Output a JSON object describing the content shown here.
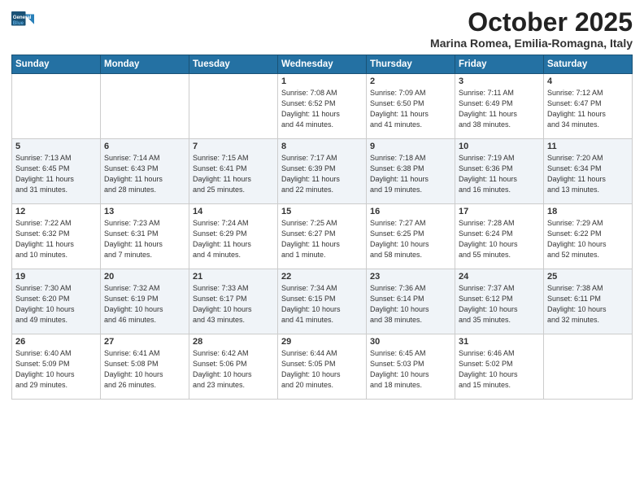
{
  "logo": {
    "line1": "General",
    "line2": "Blue"
  },
  "title": "October 2025",
  "location": "Marina Romea, Emilia-Romagna, Italy",
  "weekdays": [
    "Sunday",
    "Monday",
    "Tuesday",
    "Wednesday",
    "Thursday",
    "Friday",
    "Saturday"
  ],
  "weeks": [
    [
      {
        "day": "",
        "info": ""
      },
      {
        "day": "",
        "info": ""
      },
      {
        "day": "",
        "info": ""
      },
      {
        "day": "1",
        "info": "Sunrise: 7:08 AM\nSunset: 6:52 PM\nDaylight: 11 hours\nand 44 minutes."
      },
      {
        "day": "2",
        "info": "Sunrise: 7:09 AM\nSunset: 6:50 PM\nDaylight: 11 hours\nand 41 minutes."
      },
      {
        "day": "3",
        "info": "Sunrise: 7:11 AM\nSunset: 6:49 PM\nDaylight: 11 hours\nand 38 minutes."
      },
      {
        "day": "4",
        "info": "Sunrise: 7:12 AM\nSunset: 6:47 PM\nDaylight: 11 hours\nand 34 minutes."
      }
    ],
    [
      {
        "day": "5",
        "info": "Sunrise: 7:13 AM\nSunset: 6:45 PM\nDaylight: 11 hours\nand 31 minutes."
      },
      {
        "day": "6",
        "info": "Sunrise: 7:14 AM\nSunset: 6:43 PM\nDaylight: 11 hours\nand 28 minutes."
      },
      {
        "day": "7",
        "info": "Sunrise: 7:15 AM\nSunset: 6:41 PM\nDaylight: 11 hours\nand 25 minutes."
      },
      {
        "day": "8",
        "info": "Sunrise: 7:17 AM\nSunset: 6:39 PM\nDaylight: 11 hours\nand 22 minutes."
      },
      {
        "day": "9",
        "info": "Sunrise: 7:18 AM\nSunset: 6:38 PM\nDaylight: 11 hours\nand 19 minutes."
      },
      {
        "day": "10",
        "info": "Sunrise: 7:19 AM\nSunset: 6:36 PM\nDaylight: 11 hours\nand 16 minutes."
      },
      {
        "day": "11",
        "info": "Sunrise: 7:20 AM\nSunset: 6:34 PM\nDaylight: 11 hours\nand 13 minutes."
      }
    ],
    [
      {
        "day": "12",
        "info": "Sunrise: 7:22 AM\nSunset: 6:32 PM\nDaylight: 11 hours\nand 10 minutes."
      },
      {
        "day": "13",
        "info": "Sunrise: 7:23 AM\nSunset: 6:31 PM\nDaylight: 11 hours\nand 7 minutes."
      },
      {
        "day": "14",
        "info": "Sunrise: 7:24 AM\nSunset: 6:29 PM\nDaylight: 11 hours\nand 4 minutes."
      },
      {
        "day": "15",
        "info": "Sunrise: 7:25 AM\nSunset: 6:27 PM\nDaylight: 11 hours\nand 1 minute."
      },
      {
        "day": "16",
        "info": "Sunrise: 7:27 AM\nSunset: 6:25 PM\nDaylight: 10 hours\nand 58 minutes."
      },
      {
        "day": "17",
        "info": "Sunrise: 7:28 AM\nSunset: 6:24 PM\nDaylight: 10 hours\nand 55 minutes."
      },
      {
        "day": "18",
        "info": "Sunrise: 7:29 AM\nSunset: 6:22 PM\nDaylight: 10 hours\nand 52 minutes."
      }
    ],
    [
      {
        "day": "19",
        "info": "Sunrise: 7:30 AM\nSunset: 6:20 PM\nDaylight: 10 hours\nand 49 minutes."
      },
      {
        "day": "20",
        "info": "Sunrise: 7:32 AM\nSunset: 6:19 PM\nDaylight: 10 hours\nand 46 minutes."
      },
      {
        "day": "21",
        "info": "Sunrise: 7:33 AM\nSunset: 6:17 PM\nDaylight: 10 hours\nand 43 minutes."
      },
      {
        "day": "22",
        "info": "Sunrise: 7:34 AM\nSunset: 6:15 PM\nDaylight: 10 hours\nand 41 minutes."
      },
      {
        "day": "23",
        "info": "Sunrise: 7:36 AM\nSunset: 6:14 PM\nDaylight: 10 hours\nand 38 minutes."
      },
      {
        "day": "24",
        "info": "Sunrise: 7:37 AM\nSunset: 6:12 PM\nDaylight: 10 hours\nand 35 minutes."
      },
      {
        "day": "25",
        "info": "Sunrise: 7:38 AM\nSunset: 6:11 PM\nDaylight: 10 hours\nand 32 minutes."
      }
    ],
    [
      {
        "day": "26",
        "info": "Sunrise: 6:40 AM\nSunset: 5:09 PM\nDaylight: 10 hours\nand 29 minutes."
      },
      {
        "day": "27",
        "info": "Sunrise: 6:41 AM\nSunset: 5:08 PM\nDaylight: 10 hours\nand 26 minutes."
      },
      {
        "day": "28",
        "info": "Sunrise: 6:42 AM\nSunset: 5:06 PM\nDaylight: 10 hours\nand 23 minutes."
      },
      {
        "day": "29",
        "info": "Sunrise: 6:44 AM\nSunset: 5:05 PM\nDaylight: 10 hours\nand 20 minutes."
      },
      {
        "day": "30",
        "info": "Sunrise: 6:45 AM\nSunset: 5:03 PM\nDaylight: 10 hours\nand 18 minutes."
      },
      {
        "day": "31",
        "info": "Sunrise: 6:46 AM\nSunset: 5:02 PM\nDaylight: 10 hours\nand 15 minutes."
      },
      {
        "day": "",
        "info": ""
      }
    ]
  ]
}
